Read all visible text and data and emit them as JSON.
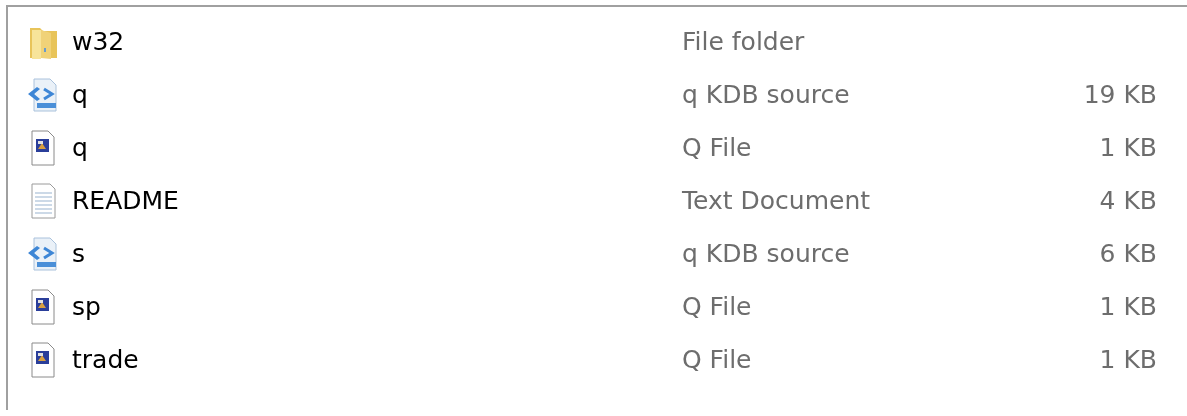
{
  "files": [
    {
      "kind": "folder",
      "name": "w32",
      "type": "File folder"
    },
    {
      "kind": "source",
      "name": "q",
      "type": "q KDB source",
      "size": "19 KB"
    },
    {
      "kind": "qfile",
      "name": "q",
      "type": "Q File",
      "size": "1 KB"
    },
    {
      "kind": "text",
      "name": "README",
      "type": "Text Document",
      "size": "4 KB"
    },
    {
      "kind": "source",
      "name": "s",
      "type": "q KDB source",
      "size": "6 KB"
    },
    {
      "kind": "qfile",
      "name": "sp",
      "type": "Q File",
      "size": "1 KB"
    },
    {
      "kind": "qfile",
      "name": "trade",
      "type": "Q File",
      "size": "1 KB"
    }
  ]
}
